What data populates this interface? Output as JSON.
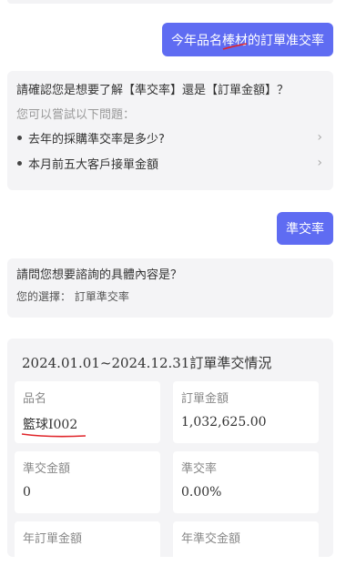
{
  "messages": {
    "user_query_pre": "今年品名",
    "user_query_marked": "棒材",
    "user_query_post": "的訂單准交率",
    "user_choice": "準交率"
  },
  "clarify_card": {
    "question": "請確認您是想要了解【準交率】還是【訂單金額】？",
    "hint": "您可以嘗試以下問題：",
    "suggestions": [
      "去年的採購準交率是多少?",
      "本月前五大客戶接單金額"
    ]
  },
  "detail_card": {
    "question": "請問您想要諮詢的具體內容是？",
    "choice": "您的選擇： 訂單準交率"
  },
  "result": {
    "title": "2024.01.01~2024.12.31訂單準交情況",
    "tiles": [
      {
        "label": "品名",
        "value": "籃球I002"
      },
      {
        "label": "訂單金額",
        "value": "1,032,625.00"
      },
      {
        "label": "準交金額",
        "value": "0"
      },
      {
        "label": "準交率",
        "value": "0.00%"
      },
      {
        "label": "年訂單金額",
        "value": ""
      },
      {
        "label": "年準交金額",
        "value": ""
      }
    ]
  },
  "colors": {
    "accent": "#5f6cf2",
    "annotation": "#e0262b",
    "card_bg": "#f4f4f6"
  },
  "icons": {
    "suggestion_arrow": "chevron-right-icon"
  }
}
